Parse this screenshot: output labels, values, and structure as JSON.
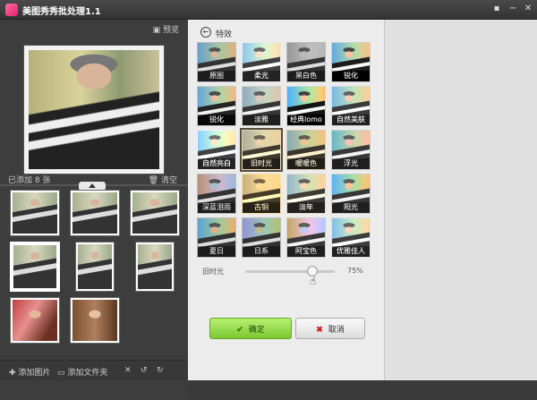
{
  "app": {
    "title": "美图秀秀批处理1.1"
  },
  "window": {
    "menu_icon": "▪",
    "minimize_icon": "−",
    "close_icon": "✕"
  },
  "left": {
    "preview_label": "预览",
    "added_label": "已添加 8 张",
    "clear_label": "清空",
    "tools": {
      "add_image": "添加图片",
      "add_folder": "添加文件夹"
    }
  },
  "panel": {
    "title": "特效",
    "effects": [
      "原图",
      "柔光",
      "黑白色",
      "锐化",
      "锐化",
      "淡雅",
      "经典lomo",
      "自然美肤",
      "自然亮白",
      "旧时光",
      "暖暖色",
      "浮光",
      "深蓝泪雨",
      "古铜",
      "淡年",
      "阳光",
      "夏日",
      "日系",
      "阿宝色",
      "优雅佳人"
    ],
    "selected_index": 9,
    "slider": {
      "label": "旧时光",
      "value": 75,
      "value_text": "75%"
    },
    "ok_label": "确定",
    "cancel_label": "取消"
  },
  "colors": {
    "ok_green": "#7cc832",
    "dark_bg": "#3a3a3a",
    "panel_bg": "#ececec"
  }
}
